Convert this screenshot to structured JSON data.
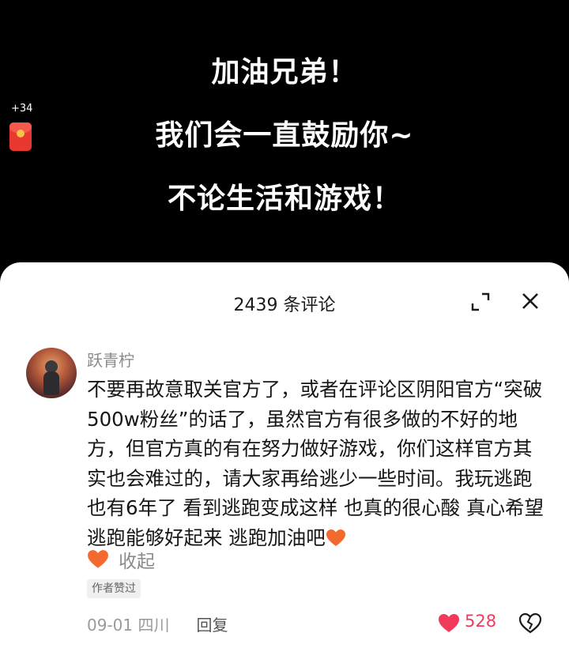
{
  "video": {
    "caption_lines": [
      "加油兄弟！",
      "我们会一直鼓励你~",
      "不论生活和游戏！"
    ],
    "red_packet_count": "+34"
  },
  "sheet": {
    "title": "2439 条评论"
  },
  "comment": {
    "username": "跃青柠",
    "text": "不要再故意取关官方了，或者在评论区阴阳官方“突破500w粉丝”的话了，虽然官方有很多做的不好的地方，但官方真的有在努力做好游戏，你们这样官方其实也会难过的，请大家再给逃少一些时间。我玩逃跑也有6年了 看到逃跑变成这样 也真的很心酸 真心希望逃跑能够好起来 逃跑加油吧",
    "collapse_label": "收起",
    "author_badge": "作者赞过",
    "date_location": "09-01 四川",
    "reply_label": "回复",
    "like_count": "528"
  },
  "colors": {
    "like": "#f23b5c",
    "heart_emoji": "#f26a2e",
    "red_packet": "#e8382f"
  },
  "icons": {
    "expand": "expand-icon",
    "close": "close-icon",
    "like": "heart-filled-icon",
    "dislike": "broken-heart-icon"
  }
}
